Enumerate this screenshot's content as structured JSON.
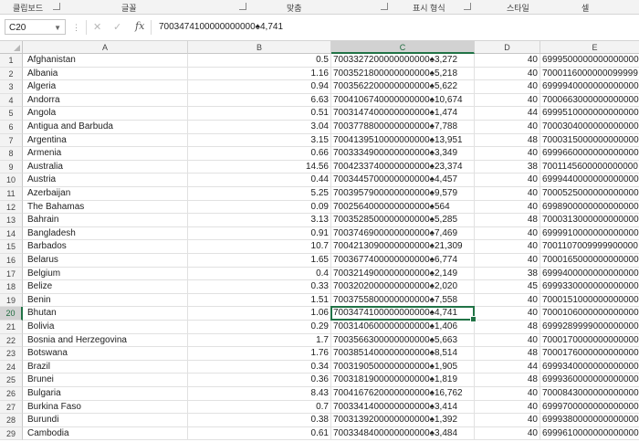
{
  "ribbon": {
    "groups": [
      "클립보드",
      "글꼴",
      "맞춤",
      "표시 형식",
      "스타일",
      "셀"
    ]
  },
  "formula_bar": {
    "name_box": "C20",
    "fx_label": "fx",
    "content": "7003474100000000000♠4,741"
  },
  "columns": [
    "A",
    "B",
    "C",
    "D",
    "E"
  ],
  "selected_column": "C",
  "selected_row": 20,
  "rows": [
    {
      "n": "1",
      "a": "Afghanistan",
      "b": "0.5",
      "c": "7003327200000000000♠3,272",
      "d": "40",
      "e": "6999500000000000000"
    },
    {
      "n": "2",
      "a": "Albania",
      "b": "1.16",
      "c": "7003521800000000000♠5,218",
      "d": "40",
      "e": "7000116000000099999"
    },
    {
      "n": "3",
      "a": "Algeria",
      "b": "0.94",
      "c": "7003562200000000000♠5,622",
      "d": "40",
      "e": "6999940000000000000"
    },
    {
      "n": "4",
      "a": "Andorra",
      "b": "6.63",
      "c": "7004106740000000000♠10,674",
      "d": "40",
      "e": "7000663000000000000"
    },
    {
      "n": "5",
      "a": "Angola",
      "b": "0.51",
      "c": "7003147400000000000♠1,474",
      "d": "44",
      "e": "6999510000000000000"
    },
    {
      "n": "6",
      "a": "Antigua and Barbuda",
      "b": "3.04",
      "c": "7003778800000000000♠7,788",
      "d": "40",
      "e": "7000304000000000000"
    },
    {
      "n": "7",
      "a": "Argentina",
      "b": "3.15",
      "c": "7004139510000000000♠13,951",
      "d": "48",
      "e": "7000315000000000000"
    },
    {
      "n": "8",
      "a": "Armenia",
      "b": "0.66",
      "c": "7003334900000000000♠3,349",
      "d": "40",
      "e": "6999660000000000000"
    },
    {
      "n": "9",
      "a": "Australia",
      "b": "14.56",
      "c": "7004233740000000000♠23,374",
      "d": "38",
      "e": "7001145600000000000"
    },
    {
      "n": "10",
      "a": "Austria",
      "b": "0.44",
      "c": "7003445700000000000♠4,457",
      "d": "40",
      "e": "6999440000000000000"
    },
    {
      "n": "11",
      "a": "Azerbaijan",
      "b": "5.25",
      "c": "7003957900000000000♠9,579",
      "d": "40",
      "e": "7000525000000000000"
    },
    {
      "n": "12",
      "a": "The Bahamas",
      "b": "0.09",
      "c": "7002564000000000000♠564",
      "d": "40",
      "e": "6998900000000000000"
    },
    {
      "n": "13",
      "a": "Bahrain",
      "b": "3.13",
      "c": "7003528500000000000♠5,285",
      "d": "48",
      "e": "7000313000000000000"
    },
    {
      "n": "14",
      "a": "Bangladesh",
      "b": "0.91",
      "c": "7003746900000000000♠7,469",
      "d": "40",
      "e": "6999910000000000000"
    },
    {
      "n": "15",
      "a": "Barbados",
      "b": "10.7",
      "c": "7004213090000000000♠21,309",
      "d": "40",
      "e": "7001107009999900000"
    },
    {
      "n": "16",
      "a": "Belarus",
      "b": "1.65",
      "c": "7003677400000000000♠6,774",
      "d": "40",
      "e": "7000165000000000000"
    },
    {
      "n": "17",
      "a": "Belgium",
      "b": "0.4",
      "c": "7003214900000000000♠2,149",
      "d": "38",
      "e": "6999400000000000000"
    },
    {
      "n": "18",
      "a": "Belize",
      "b": "0.33",
      "c": "7003202000000000000♠2,020",
      "d": "45",
      "e": "6999330000000000000"
    },
    {
      "n": "19",
      "a": "Benin",
      "b": "1.51",
      "c": "7003755800000000000♠7,558",
      "d": "40",
      "e": "7000151000000000000"
    },
    {
      "n": "20",
      "a": "Bhutan",
      "b": "1.06",
      "c": "7003474100000000000♠4,741",
      "d": "40",
      "e": "7000106000000000000"
    },
    {
      "n": "21",
      "a": "Bolivia",
      "b": "0.29",
      "c": "7003140600000000000♠1,406",
      "d": "48",
      "e": "6999289999000000000"
    },
    {
      "n": "22",
      "a": "Bosnia and Herzegovina",
      "b": "1.7",
      "c": "7003566300000000000♠5,663",
      "d": "40",
      "e": "7000170000000000000"
    },
    {
      "n": "23",
      "a": "Botswana",
      "b": "1.76",
      "c": "7003851400000000000♠8,514",
      "d": "48",
      "e": "7000176000000000000"
    },
    {
      "n": "24",
      "a": "Brazil",
      "b": "0.34",
      "c": "7003190500000000000♠1,905",
      "d": "44",
      "e": "6999340000000000000"
    },
    {
      "n": "25",
      "a": "Brunei",
      "b": "0.36",
      "c": "7003181900000000000♠1,819",
      "d": "48",
      "e": "6999360000000000000"
    },
    {
      "n": "26",
      "a": "Bulgaria",
      "b": "8.43",
      "c": "7004167620000000000♠16,762",
      "d": "40",
      "e": "7000843000000000000"
    },
    {
      "n": "27",
      "a": "Burkina Faso",
      "b": "0.7",
      "c": "7003341400000000000♠3,414",
      "d": "40",
      "e": "6999700000000000000"
    },
    {
      "n": "28",
      "a": "Burundi",
      "b": "0.38",
      "c": "7003139200000000000♠1,392",
      "d": "40",
      "e": "6999380000000000000"
    },
    {
      "n": "29",
      "a": "Cambodia",
      "b": "0.61",
      "c": "7003348400000000000♠3,484",
      "d": "40",
      "e": "6999610000000000000"
    }
  ]
}
